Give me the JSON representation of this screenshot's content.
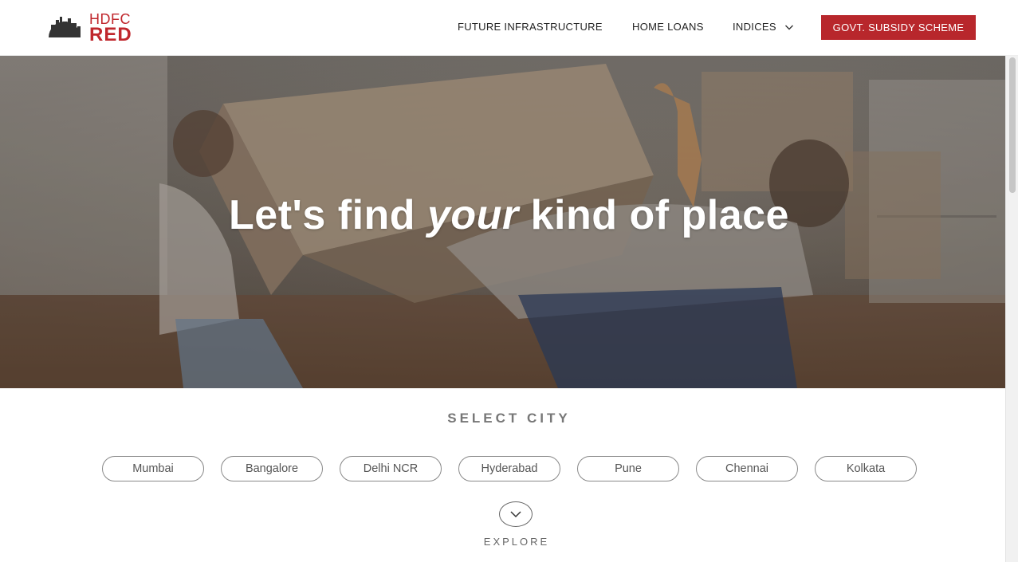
{
  "brand": {
    "logo_top": "HDFC",
    "logo_bottom": "RED",
    "brand_color": "#b8272c"
  },
  "nav": {
    "items": [
      {
        "label": "FUTURE INFRASTRUCTURE"
      },
      {
        "label": "HOME LOANS"
      },
      {
        "label": "INDICES",
        "icon": "chevron-down-icon"
      }
    ],
    "cta_label": "GOVT. SUBSIDY SCHEME"
  },
  "hero": {
    "title_pre": "Let's find ",
    "title_em": "your",
    "title_post": " kind of place"
  },
  "city_section": {
    "heading": "SELECT CITY",
    "cities": [
      "Mumbai",
      "Bangalore",
      "Delhi NCR",
      "Hyderabad",
      "Pune",
      "Chennai",
      "Kolkata"
    ]
  },
  "explore": {
    "label": "EXPLORE",
    "icon": "chevron-down-icon"
  }
}
